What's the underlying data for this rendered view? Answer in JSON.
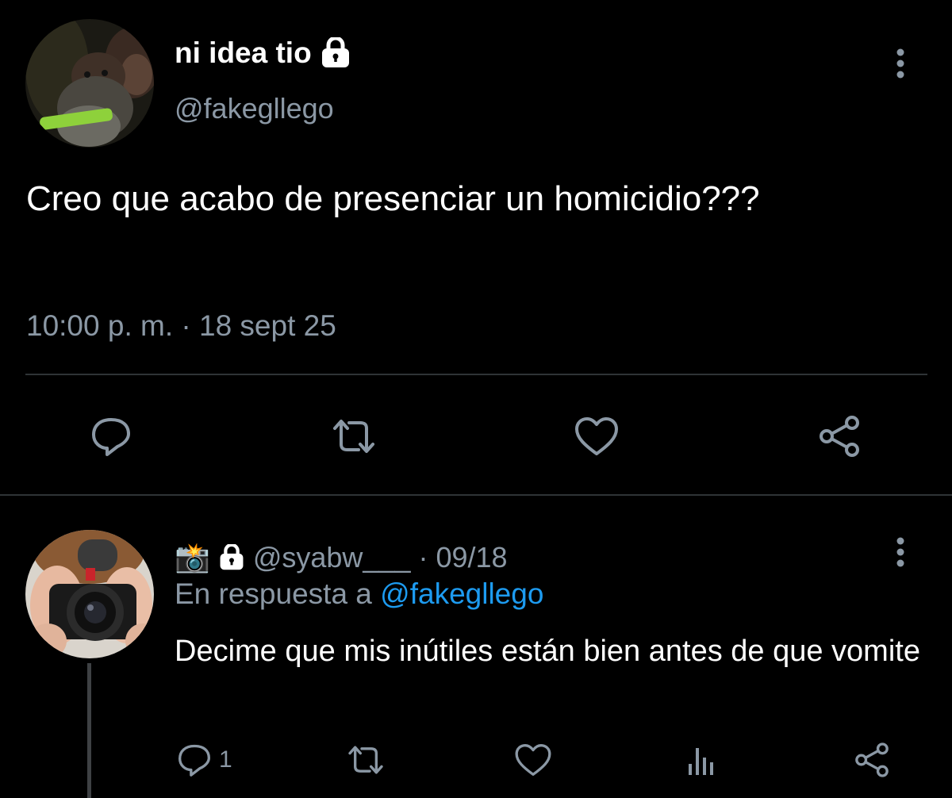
{
  "tweet": {
    "display_name": "ni idea tio",
    "handle": "@fakegllego",
    "text": "Creo que acabo de presenciar un homicidio???",
    "meta": "10:00 p. m. · 18 sept 25",
    "avatar": "profile-photo-man-with-dog",
    "icons": {
      "lock": "lock-icon",
      "more": "more-vertical-icon",
      "reply": "reply-icon",
      "retweet": "retweet-icon",
      "like": "heart-icon",
      "share": "share-icon"
    }
  },
  "reply": {
    "emoji": "📸",
    "handle": "@syabw___",
    "date": "· 09/18",
    "replying_prefix": "En respuesta a",
    "replying_mention": "@fakegllego",
    "text": "Decime que mis inútiles están bien antes de que vomite",
    "reply_count": "1",
    "avatar": "profile-photo-person-with-camera",
    "icons": {
      "reply": "reply-icon",
      "retweet": "retweet-icon",
      "like": "heart-icon",
      "analytics": "analytics-icon",
      "share": "share-icon"
    }
  },
  "colors": {
    "background": "#000000",
    "primary_text": "#ffffff",
    "secondary_text": "#8b98a5",
    "mention": "#1d9bf0",
    "divider": "#2f3336",
    "icon": "#8b98a5"
  }
}
